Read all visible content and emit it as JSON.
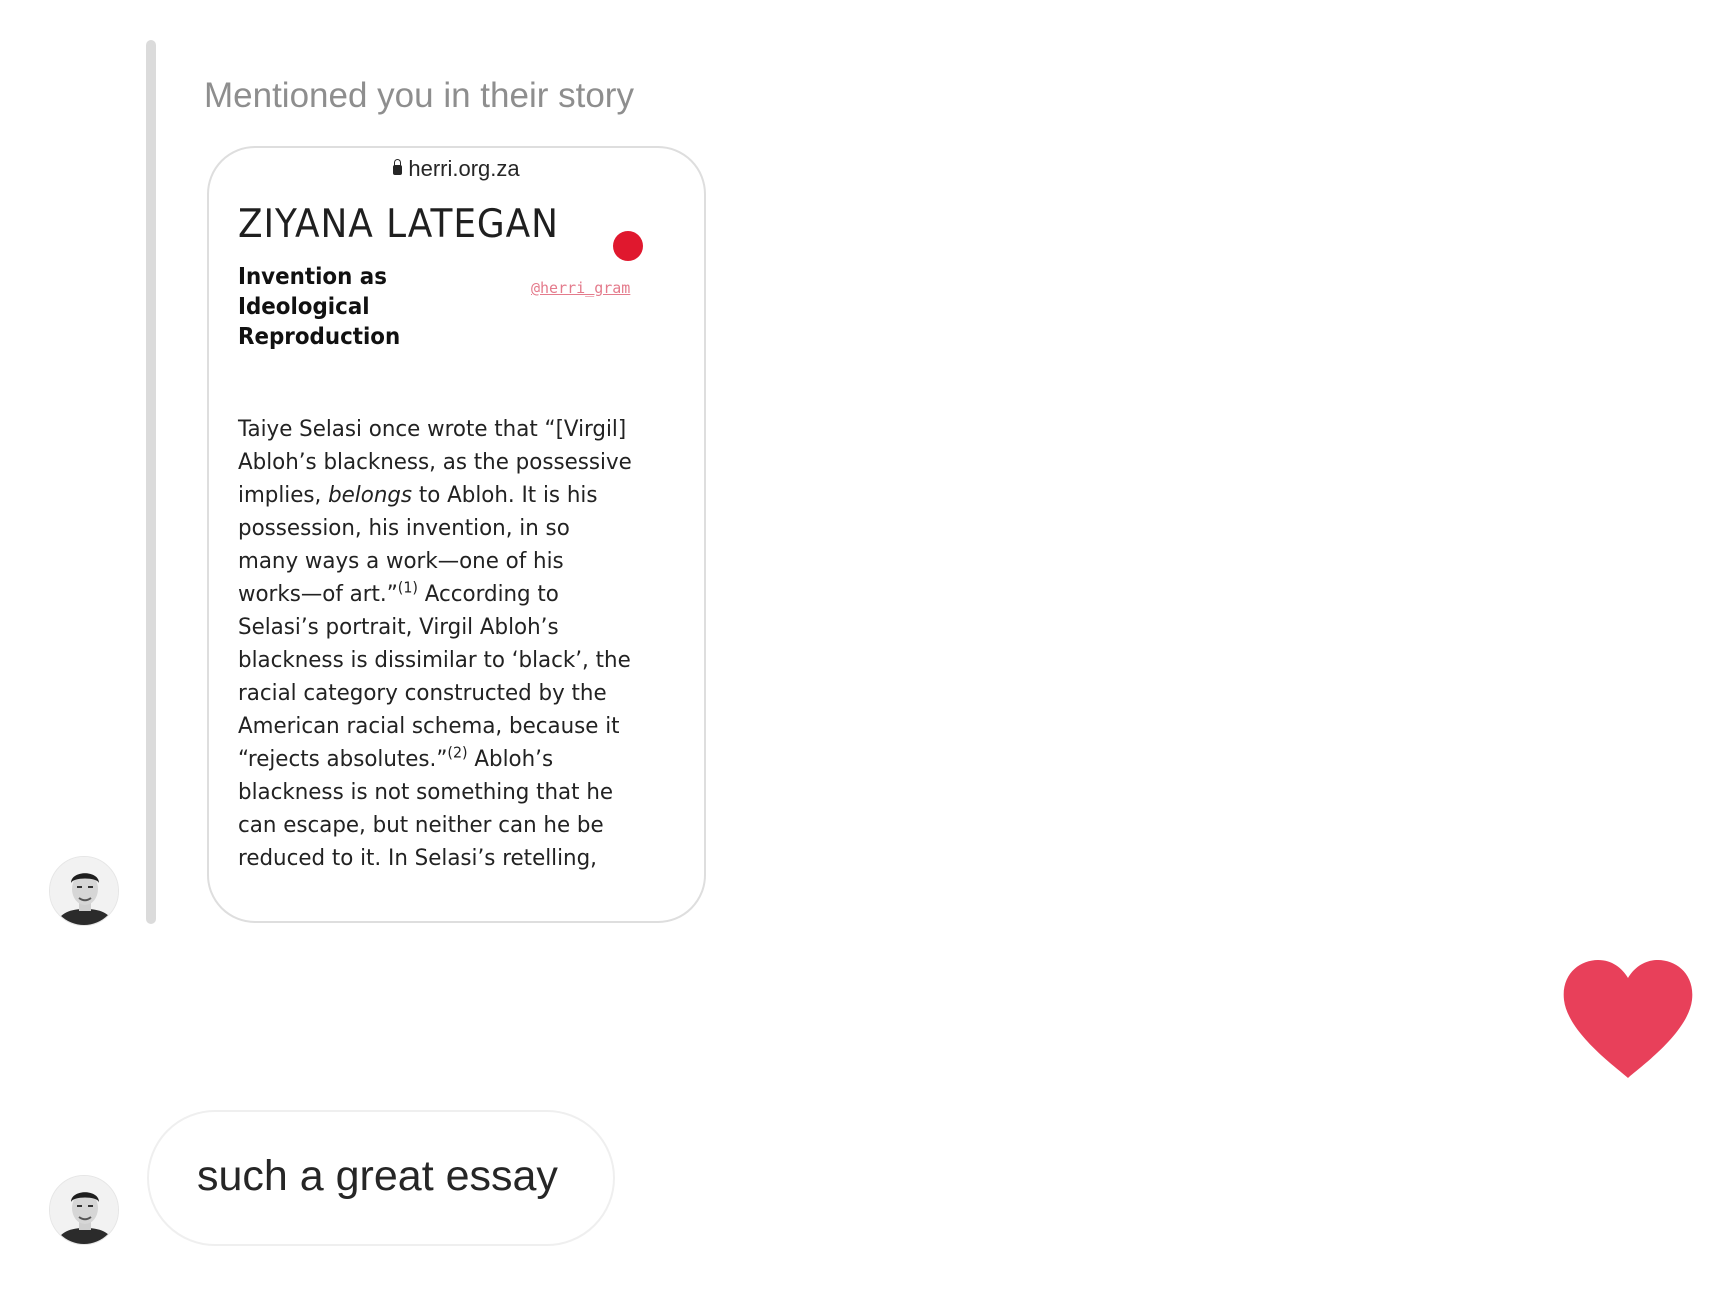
{
  "thread": {
    "story_mention": {
      "caption": "Mentioned you in their story",
      "story": {
        "url": "herri.org.za",
        "author": "ZIYANA LATEGAN",
        "title_lines": [
          "Invention as Ideological",
          "Reproduction"
        ],
        "mention_sticker": "@herri_gram",
        "dot_color": "#e0182e",
        "body_lines": [
          {
            "pre": "Taiye Selasi once wrote that “[Virgil]"
          },
          {
            "pre": "Abloh’s blackness, as the possessive"
          },
          {
            "pre": "implies, ",
            "em": "belongs",
            "post": " to Abloh. It is his"
          },
          {
            "pre": "possession, his invention, in so"
          },
          {
            "pre": "many ways a work—one of his"
          },
          {
            "pre": "works—of art.”",
            "sup": "(1)",
            "post": " According to"
          },
          {
            "pre": "Selasi’s portrait, Virgil Abloh’s"
          },
          {
            "pre": "blackness is dissimilar to ‘black’, the"
          },
          {
            "pre": "racial category constructed by the"
          },
          {
            "pre": "American racial schema, because it"
          },
          {
            "pre": "“rejects absolutes.”",
            "sup": "(2)",
            "post": " Abloh’s"
          },
          {
            "pre": "blackness is not something that he"
          },
          {
            "pre": "can escape, but neither can he be"
          },
          {
            "pre": "reduced to it. In Selasi’s retelling,"
          }
        ]
      }
    },
    "reaction": {
      "icon": "heart-icon",
      "color": "#e8405a"
    },
    "message": {
      "text": "such a great essay"
    }
  }
}
